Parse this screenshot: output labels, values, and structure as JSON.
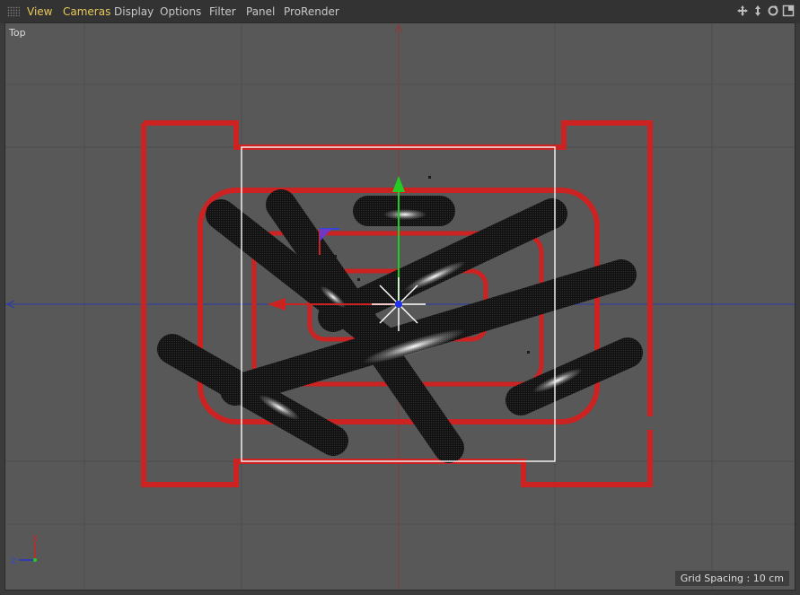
{
  "menubar": {
    "items": [
      "View",
      "Cameras",
      "Display",
      "Options",
      "Filter",
      "Panel",
      "ProRender"
    ],
    "active": [
      "View",
      "Cameras"
    ],
    "nav_icons": [
      "move-view-icon",
      "scale-view-icon",
      "rotate-view-icon",
      "toggle-views-icon"
    ]
  },
  "viewport": {
    "label": "Top",
    "grid_spacing": "Grid Spacing : 10 cm",
    "axis_gizmo": {
      "x": "X",
      "z": "Z"
    }
  },
  "colors": {
    "accent": "#e8c95a",
    "viewport_bg": "#585858",
    "outline_red": "#cc2222",
    "axis_x": "#cc2222",
    "axis_y": "#22cc22",
    "axis_z": "#2233cc"
  }
}
